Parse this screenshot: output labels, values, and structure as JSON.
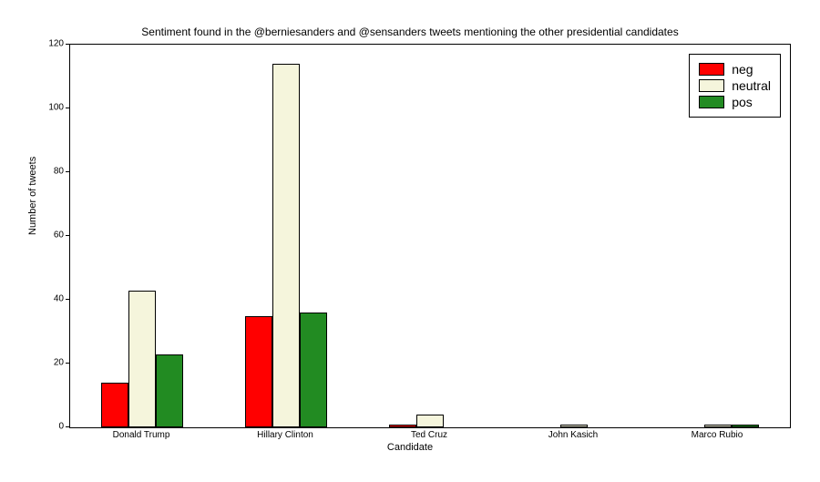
{
  "chart_data": {
    "type": "bar",
    "title": "Sentiment found in the @berniesanders and @sensanders tweets mentioning the other presidential candidates",
    "xlabel": "Candidate",
    "ylabel": "Number of tweets",
    "categories": [
      "Donald Trump",
      "Hillary Clinton",
      "Ted Cruz",
      "John Kasich",
      "Marco Rubio"
    ],
    "series": [
      {
        "name": "neg",
        "values": [
          14,
          35,
          1,
          0,
          0
        ]
      },
      {
        "name": "neutral",
        "values": [
          43,
          114,
          4,
          1,
          1
        ]
      },
      {
        "name": "pos",
        "values": [
          23,
          36,
          0,
          0,
          1
        ]
      }
    ],
    "ylim": [
      0,
      120
    ],
    "yticks": [
      0,
      20,
      40,
      60,
      80,
      100,
      120
    ],
    "legend_position": "upper right"
  },
  "legend": {
    "neg": "neg",
    "neutral": "neutral",
    "pos": "pos"
  },
  "yticks": {
    "t0": "0",
    "t1": "20",
    "t2": "40",
    "t3": "60",
    "t4": "80",
    "t5": "100",
    "t6": "120"
  },
  "cats": {
    "c0": "Donald Trump",
    "c1": "Hillary Clinton",
    "c2": "Ted Cruz",
    "c3": "John Kasich",
    "c4": "Marco Rubio"
  }
}
